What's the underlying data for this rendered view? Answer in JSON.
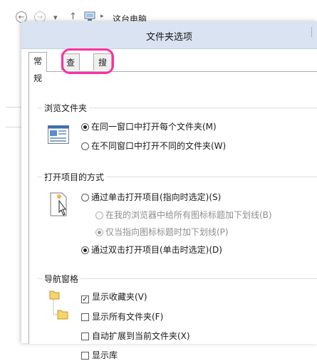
{
  "explorer": {
    "back": "←",
    "forward": "→",
    "dropdown": "▾",
    "up": "↑",
    "crumb_sep": "▸",
    "address": "这台电脑"
  },
  "dialog": {
    "title": "文件夹选项",
    "tabs": [
      "常规",
      "查看",
      "搜索"
    ],
    "browse": {
      "title": "浏览文件夹",
      "options": [
        {
          "label": "在同一窗口中打开每个文件夹(M)",
          "selected": true
        },
        {
          "label": "在不同窗口中打开不同的文件夹(W)",
          "selected": false
        }
      ]
    },
    "click": {
      "title": "打开项目的方式",
      "options": [
        {
          "label": "通过单击打开项目(指向时选定)(S)",
          "selected": false,
          "disabled": false
        },
        {
          "label": "在我的浏览器中给所有图标标题加下划线(B)",
          "selected": false,
          "disabled": true
        },
        {
          "label": "仅当指向图标标题时加下划线(P)",
          "selected": true,
          "disabled": true
        },
        {
          "label": "通过双击打开项目(单击时选定)(D)",
          "selected": true,
          "disabled": false
        }
      ]
    },
    "nav": {
      "title": "导航窗格",
      "options": [
        {
          "label": "显示收藏夹(V)",
          "checked": true
        },
        {
          "label": "显示所有文件夹(F)",
          "checked": false
        },
        {
          "label": "自动扩展到当前文件夹(X)",
          "checked": false
        },
        {
          "label": "显示库",
          "checked": false
        }
      ]
    }
  }
}
